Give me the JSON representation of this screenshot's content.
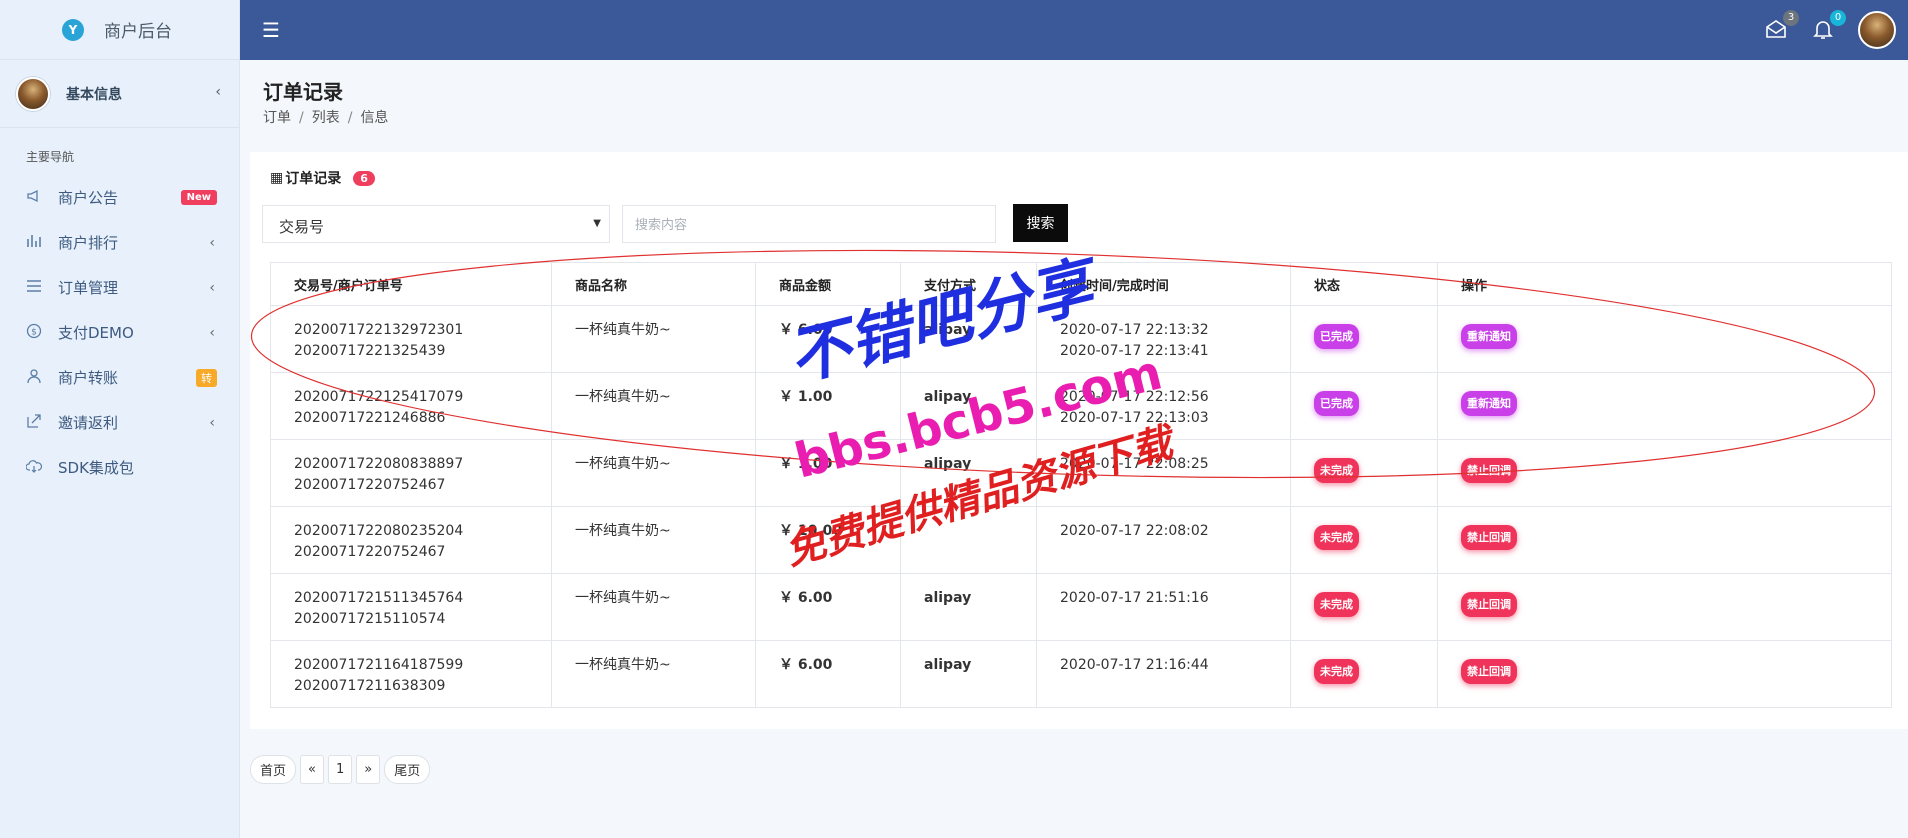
{
  "brand": {
    "title": "商户后台"
  },
  "user": {
    "label": "基本信息"
  },
  "nav": {
    "heading": "主要导航",
    "items": [
      {
        "label": "商户公告",
        "icon": "megaphone-icon",
        "badge": "New"
      },
      {
        "label": "商户排行",
        "icon": "bar-chart-icon"
      },
      {
        "label": "订单管理",
        "icon": "list-icon"
      },
      {
        "label": "支付DEMO",
        "icon": "dollar-circle-icon"
      },
      {
        "label": "商户转账",
        "icon": "user-icon",
        "badge": "转"
      },
      {
        "label": "邀请返利",
        "icon": "share-icon"
      },
      {
        "label": "SDK集成包",
        "icon": "cloud-download-icon"
      }
    ]
  },
  "topbar": {
    "mail_count": "3",
    "bell_count": "0"
  },
  "page": {
    "title": "订单记录",
    "breadcrumbs": [
      "订单",
      "列表",
      "信息"
    ]
  },
  "card": {
    "title": "订单记录",
    "count": "6",
    "select_value": "交易号",
    "search_placeholder": "搜索内容",
    "search_button": "搜索"
  },
  "table": {
    "headers": [
      "交易号/商户订单号",
      "商品名称",
      "商品金额",
      "支付方式",
      "创建时间/完成时间",
      "状态",
      "操作"
    ],
    "rows": [
      {
        "trade_no": "2020071722132972301",
        "order_no": "20200717221325439",
        "product": "一杯纯真牛奶~",
        "amount": "￥ 6.00",
        "pay": "alipay",
        "created": "2020-07-17 22:13:32",
        "finished": "2020-07-17 22:13:41",
        "status": "已完成",
        "action": "重新通知"
      },
      {
        "trade_no": "2020071722125417079",
        "order_no": "20200717221246886",
        "product": "一杯纯真牛奶~",
        "amount": "￥ 1.00",
        "pay": "alipay",
        "created": "2020-07-17 22:12:56",
        "finished": "2020-07-17 22:13:03",
        "status": "已完成",
        "action": "重新通知"
      },
      {
        "trade_no": "2020071722080838897",
        "order_no": "20200717220752467",
        "product": "一杯纯真牛奶~",
        "amount": "￥ 1.00",
        "pay": "alipay",
        "created": "2020-07-17 22:08:25",
        "finished": "",
        "status": "未完成",
        "action": "禁止回调"
      },
      {
        "trade_no": "2020071722080235204",
        "order_no": "20200717220752467",
        "product": "一杯纯真牛奶~",
        "amount": "￥ 10.00",
        "pay": "",
        "created": "2020-07-17 22:08:02",
        "finished": "",
        "status": "未完成",
        "action": "禁止回调"
      },
      {
        "trade_no": "2020071721511345764",
        "order_no": "20200717215110574",
        "product": "一杯纯真牛奶~",
        "amount": "￥ 6.00",
        "pay": "alipay",
        "created": "2020-07-17 21:51:16",
        "finished": "",
        "status": "未完成",
        "action": "禁止回调"
      },
      {
        "trade_no": "2020071721164187599",
        "order_no": "20200717211638309",
        "product": "一杯纯真牛奶~",
        "amount": "￥ 6.00",
        "pay": "alipay",
        "created": "2020-07-17 21:16:44",
        "finished": "",
        "status": "未完成",
        "action": "禁止回调"
      }
    ]
  },
  "pagination": {
    "first": "首页",
    "prev": "«",
    "current": "1",
    "next": "»",
    "last": "尾页"
  },
  "watermark": {
    "line1": "不错吧分享",
    "line2": "bbs.bcb5.com",
    "line3": "免费提供精品资源下载"
  }
}
